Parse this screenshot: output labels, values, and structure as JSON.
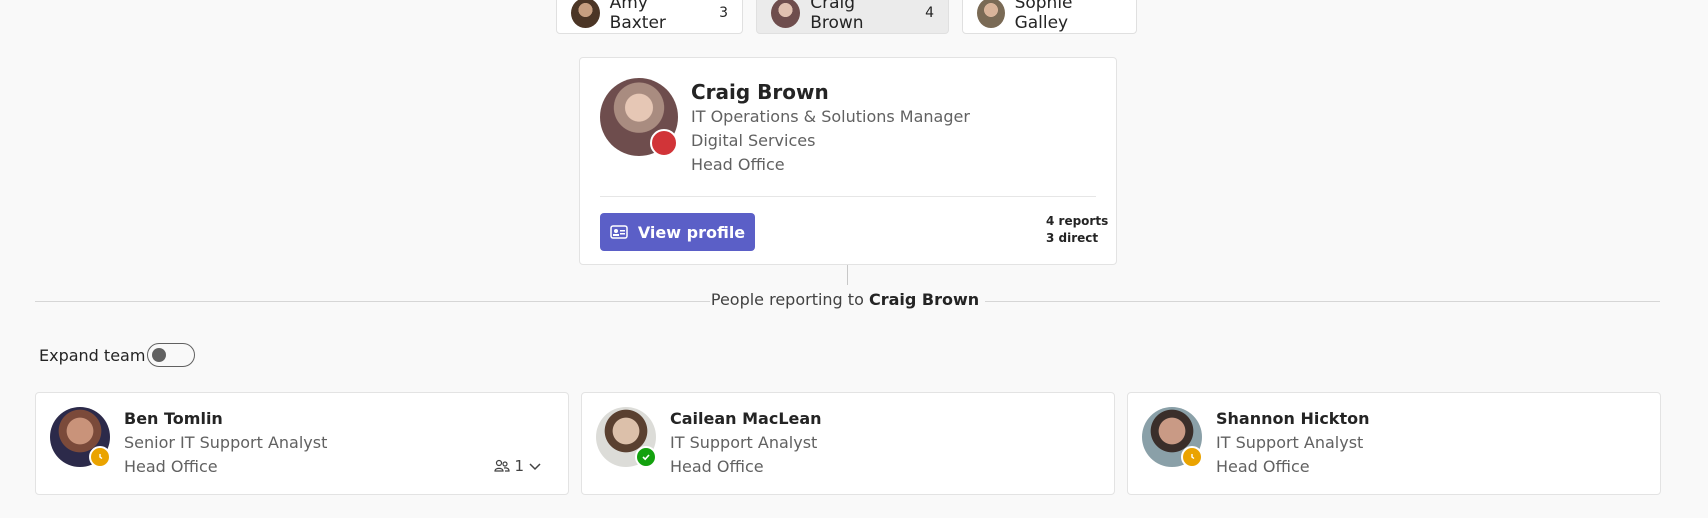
{
  "chips": [
    {
      "name": "Amy Baxter",
      "count": "3"
    },
    {
      "name": "Craig Brown",
      "count": "4"
    },
    {
      "name": "Sophie Galley",
      "count": ""
    }
  ],
  "profile": {
    "name": "Craig Brown",
    "title": "IT Operations & Solutions Manager",
    "department": "Digital Services",
    "office": "Head Office",
    "view_profile": "View profile",
    "reports": "4 reports",
    "direct": "3 direct",
    "status_color": "#d13438"
  },
  "reporting": {
    "prefix": "People reporting to",
    "manager": "Craig Brown"
  },
  "expand_team": {
    "label": "Expand team",
    "on": false
  },
  "reports": [
    {
      "name": "Ben Tomlin",
      "title": "Senior IT Support Analyst",
      "office": "Head Office",
      "status": "away",
      "team_count": "1"
    },
    {
      "name": "Cailean MacLean",
      "title": "IT Support Analyst",
      "office": "Head Office",
      "status": "available"
    },
    {
      "name": "Shannon Hickton",
      "title": "IT Support Analyst",
      "office": "Head Office",
      "status": "away"
    }
  ]
}
